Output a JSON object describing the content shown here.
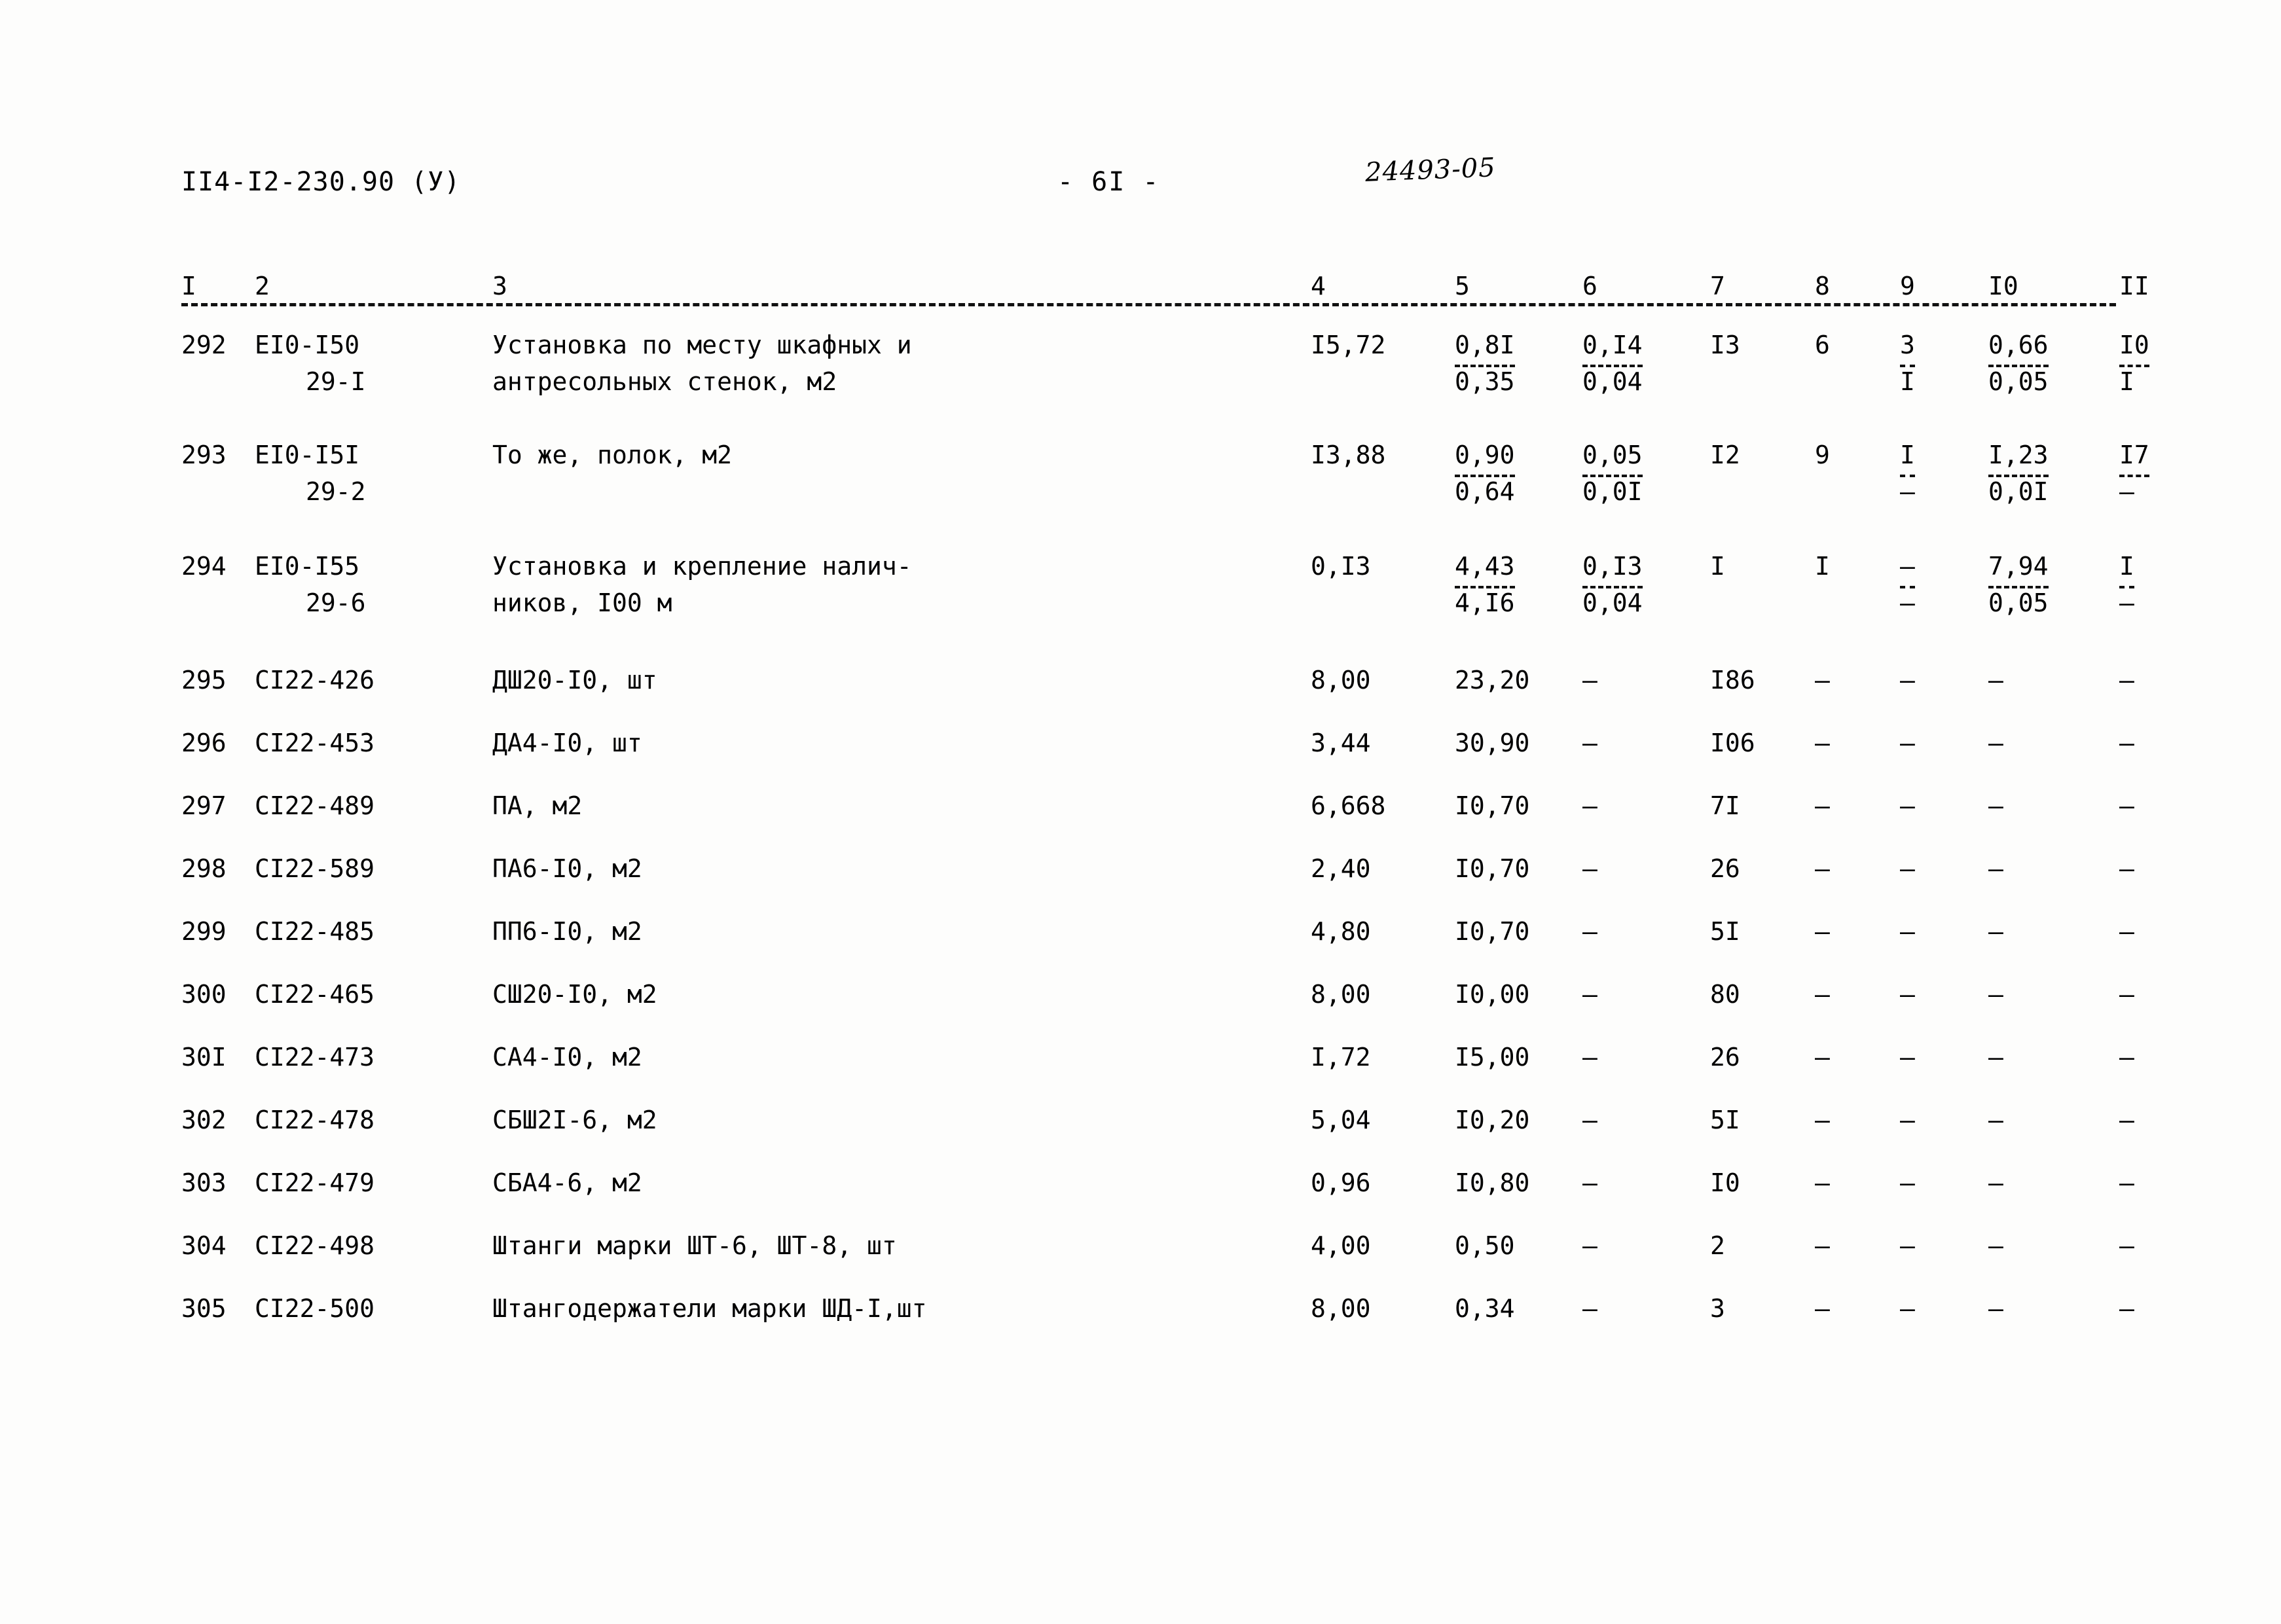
{
  "header": {
    "doc_code": "II4-I2-230.90 (У)",
    "page_label": "- 6I -",
    "stamp": "24493-05"
  },
  "table": {
    "column_headers": [
      "I",
      "2",
      "3",
      "4",
      "5",
      "6",
      "7",
      "8",
      "9",
      "I0",
      "II"
    ],
    "rows": [
      {
        "num": "292",
        "code_l1": "ЕI0-I50",
        "code_l2": "29-I",
        "name_l1": "Установка по месту шкафных и",
        "name_l2": "антресольных стенок, м2",
        "c4": "I5,72",
        "c5_top": "0,8I",
        "c5_bot": "0,35",
        "c6_top": "0,I4",
        "c6_bot": "0,04",
        "c7": "I3",
        "c8": "6",
        "c9_top": "3",
        "c9_bot": "I",
        "c10_top": "0,66",
        "c10_bot": "0,05",
        "c11_top": "I0",
        "c11_bot": "I"
      },
      {
        "num": "293",
        "code_l1": "ЕI0-I5I",
        "code_l2": "29-2",
        "name_l1": "То же, полок, м2",
        "name_l2": "",
        "c4": "I3,88",
        "c5_top": "0,90",
        "c5_bot": "0,64",
        "c6_top": "0,05",
        "c6_bot": "0,0I",
        "c7": "I2",
        "c8": "9",
        "c9_top": "I",
        "c9_bot": "–",
        "c10_top": "I,23",
        "c10_bot": "0,0I",
        "c11_top": "I7",
        "c11_bot": "–"
      },
      {
        "num": "294",
        "code_l1": "ЕI0-I55",
        "code_l2": "29-6",
        "name_l1": "Установка и крепление налич-",
        "name_l2": "ников, I00 м",
        "c4": "0,I3",
        "c5_top": "4,43",
        "c5_bot": "4,I6",
        "c6_top": "0,I3",
        "c6_bot": "0,04",
        "c7": "I",
        "c8": "I",
        "c9_top": "–",
        "c9_bot": "–",
        "c10_top": "7,94",
        "c10_bot": "0,05",
        "c11_top": "I",
        "c11_bot": "–"
      },
      {
        "num": "295",
        "code_l1": "СI22-426",
        "code_l2": "",
        "name_l1": "ДШ20-I0, шт",
        "name_l2": "",
        "c4": "8,00",
        "c5_top": "23,20",
        "c5_bot": "",
        "c6_top": "–",
        "c6_bot": "",
        "c7": "I86",
        "c8": "–",
        "c9_top": "–",
        "c9_bot": "",
        "c10_top": "–",
        "c10_bot": "",
        "c11_top": "–",
        "c11_bot": ""
      },
      {
        "num": "296",
        "code_l1": "СI22-453",
        "code_l2": "",
        "name_l1": "ДА4-I0, шт",
        "name_l2": "",
        "c4": "3,44",
        "c5_top": "30,90",
        "c5_bot": "",
        "c6_top": "–",
        "c6_bot": "",
        "c7": "I06",
        "c8": "–",
        "c9_top": "–",
        "c9_bot": "",
        "c10_top": "–",
        "c10_bot": "",
        "c11_top": "–",
        "c11_bot": ""
      },
      {
        "num": "297",
        "code_l1": "СI22-489",
        "code_l2": "",
        "name_l1": "ПА, м2",
        "name_l2": "",
        "c4": "6,668",
        "c5_top": "I0,70",
        "c5_bot": "",
        "c6_top": "–",
        "c6_bot": "",
        "c7": "7I",
        "c8": "–",
        "c9_top": "–",
        "c9_bot": "",
        "c10_top": "–",
        "c10_bot": "",
        "c11_top": "–",
        "c11_bot": ""
      },
      {
        "num": "298",
        "code_l1": "СI22-589",
        "code_l2": "",
        "name_l1": "ПА6-I0, м2",
        "name_l2": "",
        "c4": "2,40",
        "c5_top": "I0,70",
        "c5_bot": "",
        "c6_top": "–",
        "c6_bot": "",
        "c7": "26",
        "c8": "–",
        "c9_top": "–",
        "c9_bot": "",
        "c10_top": "–",
        "c10_bot": "",
        "c11_top": "–",
        "c11_bot": ""
      },
      {
        "num": "299",
        "code_l1": "СI22-485",
        "code_l2": "",
        "name_l1": "ПП6-I0, м2",
        "name_l2": "",
        "c4": "4,80",
        "c5_top": "I0,70",
        "c5_bot": "",
        "c6_top": "–",
        "c6_bot": "",
        "c7": "5I",
        "c8": "–",
        "c9_top": "–",
        "c9_bot": "",
        "c10_top": "–",
        "c10_bot": "",
        "c11_top": "–",
        "c11_bot": ""
      },
      {
        "num": "300",
        "code_l1": "СI22-465",
        "code_l2": "",
        "name_l1": "СШ20-I0, м2",
        "name_l2": "",
        "c4": "8,00",
        "c5_top": "I0,00",
        "c5_bot": "",
        "c6_top": "–",
        "c6_bot": "",
        "c7": "80",
        "c8": "–",
        "c9_top": "–",
        "c9_bot": "",
        "c10_top": "–",
        "c10_bot": "",
        "c11_top": "–",
        "c11_bot": ""
      },
      {
        "num": "30I",
        "code_l1": "СI22-473",
        "code_l2": "",
        "name_l1": "СА4-I0, м2",
        "name_l2": "",
        "c4": "I,72",
        "c5_top": "I5,00",
        "c5_bot": "",
        "c6_top": "–",
        "c6_bot": "",
        "c7": "26",
        "c8": "–",
        "c9_top": "–",
        "c9_bot": "",
        "c10_top": "–",
        "c10_bot": "",
        "c11_top": "–",
        "c11_bot": ""
      },
      {
        "num": "302",
        "code_l1": "СI22-478",
        "code_l2": "",
        "name_l1": "СБШ2I-6, м2",
        "name_l2": "",
        "c4": "5,04",
        "c5_top": "I0,20",
        "c5_bot": "",
        "c6_top": "–",
        "c6_bot": "",
        "c7": "5I",
        "c8": "–",
        "c9_top": "–",
        "c9_bot": "",
        "c10_top": "–",
        "c10_bot": "",
        "c11_top": "–",
        "c11_bot": ""
      },
      {
        "num": "303",
        "code_l1": "СI22-479",
        "code_l2": "",
        "name_l1": "СБА4-6, м2",
        "name_l2": "",
        "c4": "0,96",
        "c5_top": "I0,80",
        "c5_bot": "",
        "c6_top": "–",
        "c6_bot": "",
        "c7": "I0",
        "c8": "–",
        "c9_top": "–",
        "c9_bot": "",
        "c10_top": "–",
        "c10_bot": "",
        "c11_top": "–",
        "c11_bot": ""
      },
      {
        "num": "304",
        "code_l1": "СI22-498",
        "code_l2": "",
        "name_l1": "Штанги марки ШТ-6, ШТ-8, шт",
        "name_l2": "",
        "c4": "4,00",
        "c5_top": "0,50",
        "c5_bot": "",
        "c6_top": "–",
        "c6_bot": "",
        "c7": "2",
        "c8": "–",
        "c9_top": "–",
        "c9_bot": "",
        "c10_top": "–",
        "c10_bot": "",
        "c11_top": "–",
        "c11_bot": ""
      },
      {
        "num": "305",
        "code_l1": "СI22-500",
        "code_l2": "",
        "name_l1": "Штангодержатели марки ШД-I,шт",
        "name_l2": "",
        "c4": "8,00",
        "c5_top": "0,34",
        "c5_bot": "",
        "c6_top": "–",
        "c6_bot": "",
        "c7": "3",
        "c8": "–",
        "c9_top": "–",
        "c9_bot": "",
        "c10_top": "–",
        "c10_bot": "",
        "c11_top": "–",
        "c11_bot": ""
      }
    ]
  }
}
